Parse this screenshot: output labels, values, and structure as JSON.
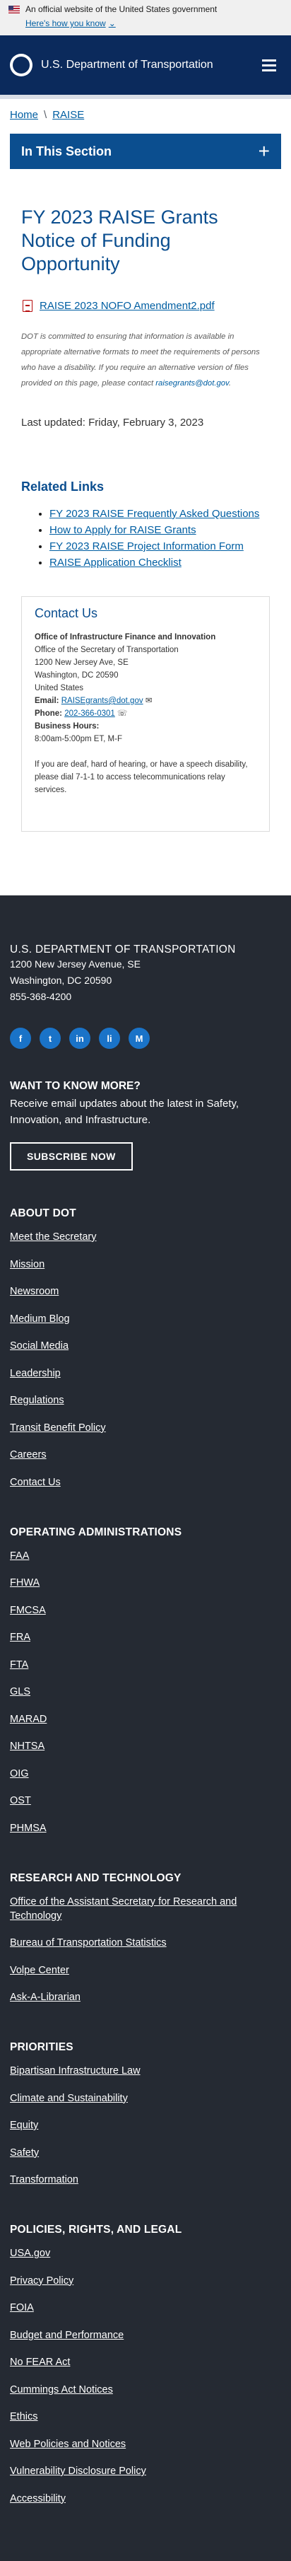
{
  "gov_banner": {
    "text": "An official website of the United States government",
    "how_know": "Here's how you know"
  },
  "header": {
    "site_name": "U.S. Department of Transportation"
  },
  "breadcrumb": [
    {
      "label": "Home"
    },
    {
      "label": "RAISE"
    }
  ],
  "section_nav": {
    "label": "In This Section"
  },
  "page": {
    "title": "FY 2023 RAISE Grants Notice of Funding Opportunity",
    "document_link": "RAISE 2023 NOFO Amendment2.pdf",
    "notice_text": "DOT is committed to ensuring that information is available in appropriate alternative formats to meet the requirements of persons who have a disability. If you require an alternative version of files provided on this page, please contact",
    "notice_email": "raisegrants@dot.gov",
    "notice_end": ".",
    "last_updated": "Last updated: Friday, February 3, 2023"
  },
  "related_links": {
    "title": "Related Links",
    "items": [
      "FY 2023 RAISE Frequently Asked Questions",
      "How to Apply for RAISE Grants",
      "FY 2023 RAISE Project Information Form",
      "RAISE Application Checklist"
    ]
  },
  "contact": {
    "title": "Contact Us",
    "office": "Office of Infrastructure Finance and Innovation",
    "line1": "Office of the Secretary of Transportation",
    "line2": "1200 New Jersey Ave, SE",
    "line3": "Washington, DC 20590",
    "line4": "United States",
    "email_label": "Email:",
    "email": "RAISEgrants@dot.gov",
    "phone_label": "Phone:",
    "phone": "202-366-0301",
    "hours_label": "Business Hours:",
    "hours": "8:00am-5:00pm ET, M-F",
    "deaf_text": "If you are deaf, hard of hearing, or have a speech disability, please dial 7-1-1 to access telecommunications relay services."
  },
  "footer": {
    "org": "U.S. DEPARTMENT OF TRANSPORTATION",
    "address1": "1200 New Jersey Avenue, SE",
    "address2": "Washington, DC 20590",
    "phone": "855-368-4200",
    "socials": [
      "f",
      "t",
      "in",
      "li",
      "M"
    ],
    "know_more_title": "WANT TO KNOW MORE?",
    "know_more_text": "Receive email updates about the latest in Safety, Innovation, and Infrastructure.",
    "subscribe": "SUBSCRIBE NOW",
    "sections": [
      {
        "title": "ABOUT DOT",
        "links": [
          "Meet the Secretary",
          "Mission",
          "Newsroom",
          "Medium Blog",
          "Social Media",
          "Leadership",
          "Regulations",
          "Transit Benefit Policy",
          "Careers",
          "Contact Us"
        ]
      },
      {
        "title": "OPERATING ADMINISTRATIONS",
        "links": [
          "FAA",
          "FHWA",
          "FMCSA",
          "FRA",
          "FTA",
          "GLS",
          "MARAD",
          "NHTSA",
          "OIG",
          "OST",
          "PHMSA"
        ]
      },
      {
        "title": "RESEARCH AND TECHNOLOGY",
        "links": [
          "Office of the Assistant Secretary for Research and Technology",
          "Bureau of Transportation Statistics",
          "Volpe Center",
          "Ask-A-Librarian"
        ]
      },
      {
        "title": "PRIORITIES",
        "links": [
          "Bipartisan Infrastructure Law",
          "Climate and Sustainability",
          "Equity",
          "Safety",
          "Transformation"
        ]
      },
      {
        "title": "POLICIES, RIGHTS, AND LEGAL",
        "links": [
          "USA.gov",
          "Privacy Policy",
          "FOIA",
          "Budget and Performance",
          "No FEAR Act",
          "Cummings Act Notices",
          "Ethics",
          "Web Policies and Notices",
          "Vulnerability Disclosure Policy",
          "Accessibility"
        ]
      }
    ]
  }
}
